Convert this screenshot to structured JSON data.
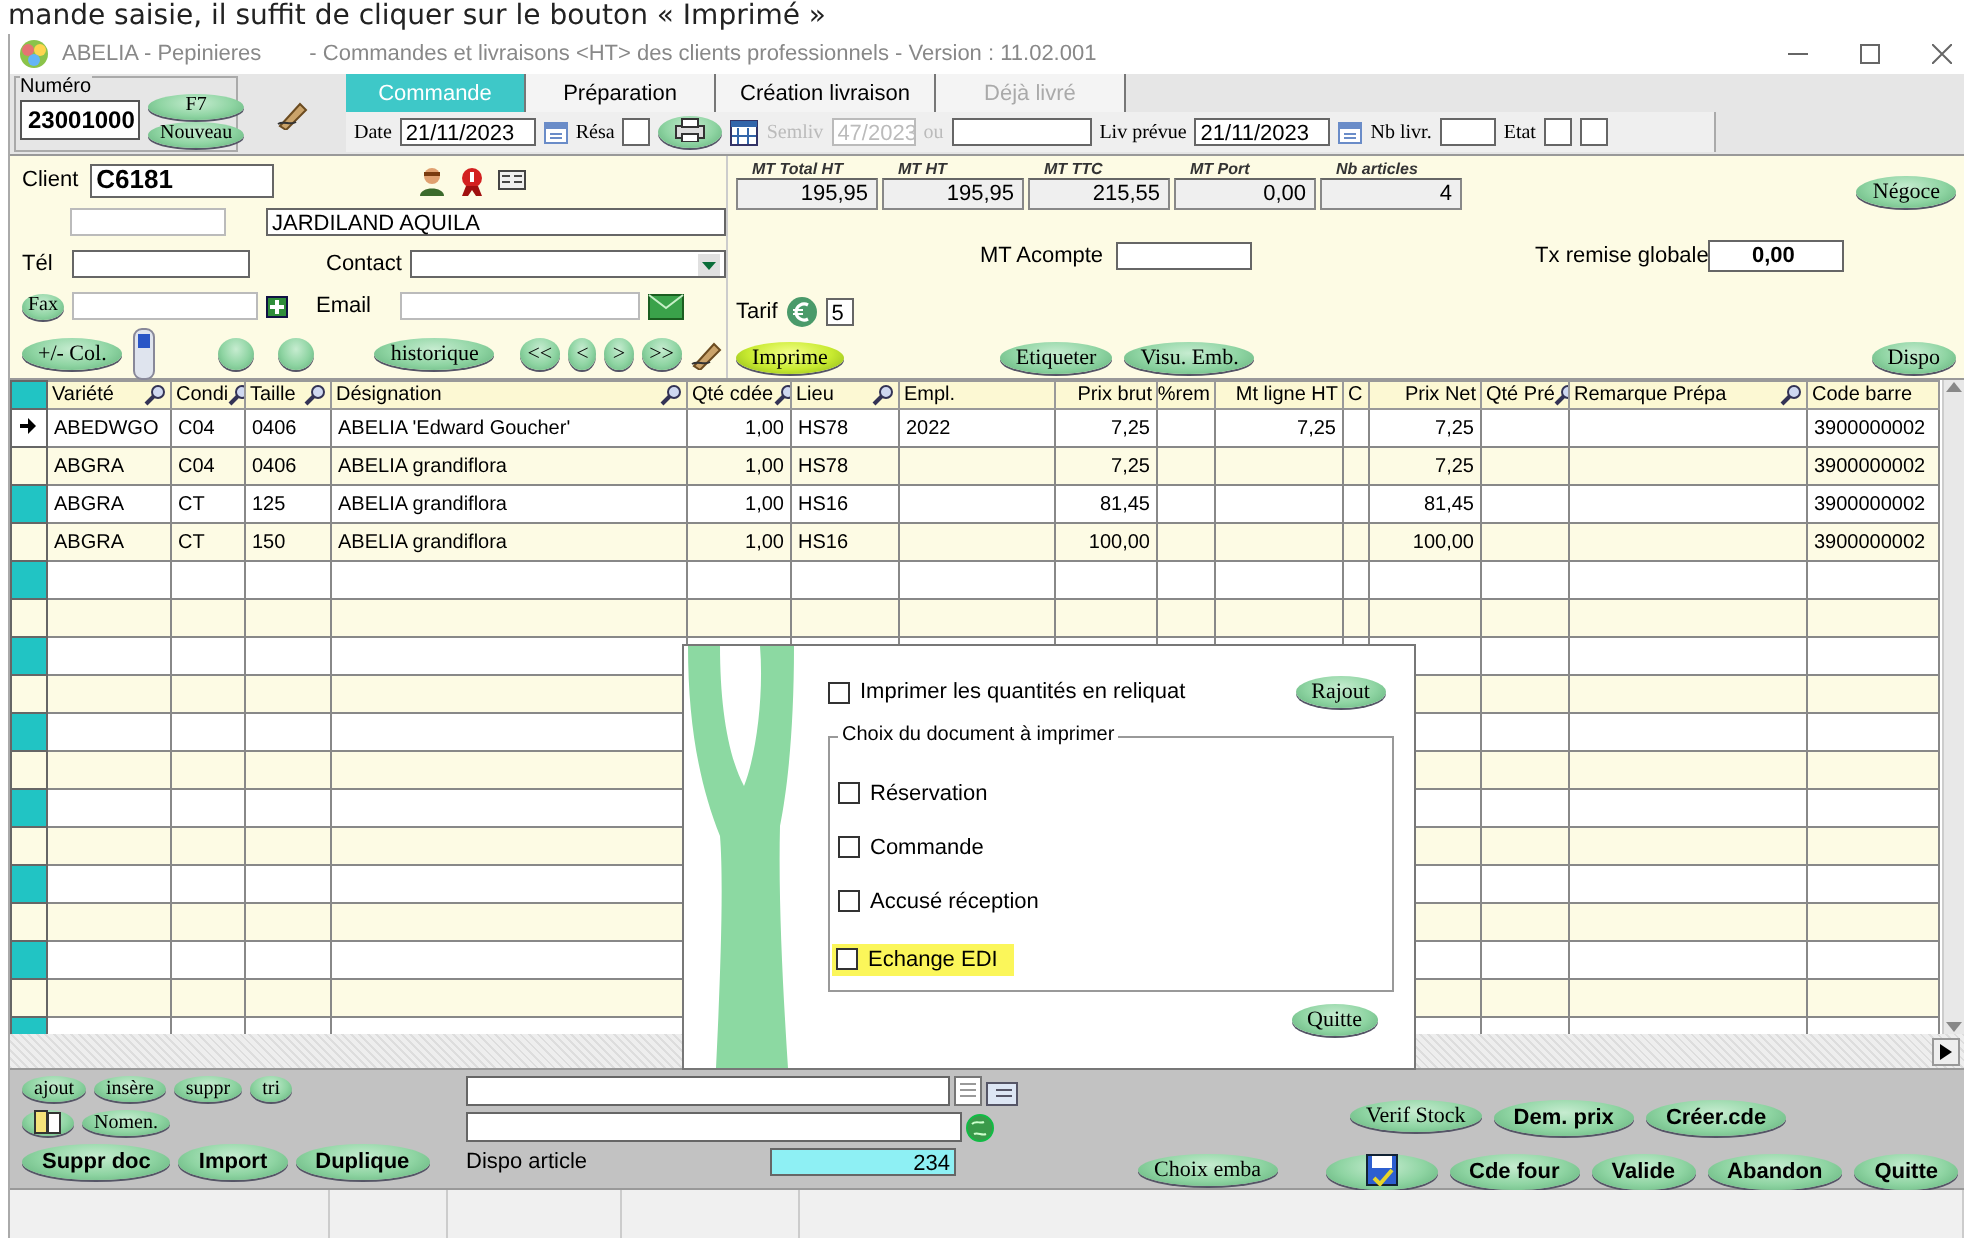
{
  "caption": "mande saisie, il suffit de cliquer sur le bouton « Imprimé »",
  "window": {
    "app": "ABELIA  -  Pepinieres",
    "title": "-  Commandes et livraisons <HT> des clients professionnels  -  Version : 11.02.001"
  },
  "numero": {
    "label": "Numéro",
    "value": "23001000",
    "buttons": [
      "F7",
      "Nouveau"
    ]
  },
  "tabs": [
    {
      "label": "Commande",
      "selected": true,
      "disabled": false
    },
    {
      "label": "Préparation",
      "selected": false,
      "disabled": false
    },
    {
      "label": "Création livraison",
      "selected": false,
      "disabled": false
    },
    {
      "label": "Déjà livré",
      "selected": false,
      "disabled": true
    }
  ],
  "order_bar": {
    "date_label": "Date",
    "date": "21/11/2023",
    "resa_label": "Résa",
    "week_label": "Semliv",
    "week": "47/2023",
    "or_label": "ou",
    "week_disabled": true,
    "delivery_label": "Liv prévue",
    "delivery_date": "21/11/2023",
    "nb_label": "Nb livr.",
    "state_label": "Etat"
  },
  "client": {
    "label": "Client",
    "code": "C6181",
    "name": "JARDILAND AQUILA",
    "phone_label": "Tél",
    "contact_label": "Contact",
    "fax_button": "Fax",
    "email_label": "Email",
    "columns_button": "+/- Col.",
    "history_button": "historique",
    "nav_buttons": [
      "<<",
      "<",
      ">",
      ">>"
    ]
  },
  "totals": [
    {
      "label": "MT Total HT",
      "value": "195,95"
    },
    {
      "label": "MT HT",
      "value": "195,95"
    },
    {
      "label": "MT TTC",
      "value": "215,55"
    },
    {
      "label": "MT Port",
      "value": "0,00"
    },
    {
      "label": "Nb articles",
      "value": "4"
    }
  ],
  "acompte_label": "MT Acompte",
  "remise": {
    "label": "Tx remise globale",
    "value": "0,00"
  },
  "tarif": {
    "label": "Tarif",
    "value": "5"
  },
  "action_buttons": [
    {
      "label": "Imprime",
      "kind": "highlight"
    },
    {
      "label": "Etiqueter",
      "kind": "plain"
    },
    {
      "label": "Visu. Emb.",
      "kind": "plain"
    }
  ],
  "side_buttons": [
    "Négoce",
    "Dispo"
  ],
  "table": {
    "columns": [
      {
        "label": "Variété",
        "searchable": true,
        "numeric": false
      },
      {
        "label": "Condi",
        "searchable": true,
        "numeric": false
      },
      {
        "label": "Taille",
        "searchable": true,
        "numeric": false
      },
      {
        "label": "Désignation",
        "searchable": true,
        "numeric": false
      },
      {
        "label": "Qté cdée",
        "searchable": true,
        "numeric": true
      },
      {
        "label": "Lieu",
        "searchable": true,
        "numeric": false
      },
      {
        "label": "Empl.",
        "searchable": false,
        "numeric": false
      },
      {
        "label": "Prix brut",
        "searchable": false,
        "numeric": true
      },
      {
        "label": "%rem",
        "searchable": false,
        "numeric": true
      },
      {
        "label": "Mt ligne HT",
        "searchable": false,
        "numeric": true
      },
      {
        "label": "C",
        "searchable": false,
        "numeric": false
      },
      {
        "label": "Prix Net",
        "searchable": false,
        "numeric": true
      },
      {
        "label": "Qté Pré",
        "searchable": true,
        "numeric": true
      },
      {
        "label": "Remarque Prépa",
        "searchable": true,
        "numeric": false
      },
      {
        "label": "Code barre",
        "searchable": false,
        "numeric": false
      }
    ],
    "rows": [
      {
        "current": true,
        "cells": [
          "ABEDWGO",
          "C04",
          "0406",
          "ABELIA 'Edward Goucher'",
          "1,00",
          "HS78",
          "2022",
          "7,25",
          null,
          "7,25",
          null,
          "7,25",
          null,
          null,
          "3900000002"
        ]
      },
      {
        "current": false,
        "cells": [
          "ABGRA",
          "C04",
          "0406",
          "ABELIA grandiflora",
          "1,00",
          "HS78",
          null,
          "7,25",
          null,
          null,
          null,
          "7,25",
          null,
          null,
          "3900000002"
        ]
      },
      {
        "current": false,
        "cells": [
          "ABGRA",
          "CT",
          "125",
          "ABELIA grandiflora",
          "1,00",
          "HS16",
          null,
          "81,45",
          null,
          null,
          null,
          "81,45",
          null,
          null,
          "3900000002"
        ]
      },
      {
        "current": false,
        "cells": [
          "ABGRA",
          "CT",
          "150",
          "ABELIA grandiflora",
          "1,00",
          "HS16",
          null,
          "100,00",
          null,
          null,
          null,
          "100,00",
          null,
          null,
          "3900000002"
        ]
      }
    ]
  },
  "dialog": {
    "reliquat": {
      "label": "Imprimer les quantités en reliquat",
      "checked": false
    },
    "add_button": "Rajout",
    "group_title": "Choix du document à imprimer",
    "documents": [
      {
        "label": "Réservation",
        "checked": false,
        "highlighted": false
      },
      {
        "label": "Commande",
        "checked": false,
        "highlighted": false
      },
      {
        "label": "Accusé réception",
        "checked": false,
        "highlighted": false
      },
      {
        "label": "Echange EDI",
        "checked": false,
        "highlighted": true
      }
    ],
    "close_button": "Quitte"
  },
  "edit_buttons": [
    "ajout",
    "insère",
    "suppr",
    "tri"
  ],
  "nomen_button": "Nomen.",
  "doc_buttons": [
    "Suppr doc",
    "Import",
    "Duplique"
  ],
  "dispo": {
    "label": "Dispo article",
    "value": "234"
  },
  "stock_buttons": [
    {
      "label": "Verif Stock",
      "kind": "plain"
    },
    {
      "label": "Dem. prix",
      "kind": "bold"
    },
    {
      "label": "Créer.cde",
      "kind": "bold"
    }
  ],
  "final_buttons": [
    {
      "label": "Choix emba",
      "kind": "plain"
    },
    {
      "kind": "save"
    },
    {
      "label": "Cde four",
      "kind": "bold"
    },
    {
      "label": "Valide",
      "kind": "bold"
    },
    {
      "label": "Abandon",
      "kind": "bold"
    },
    {
      "label": "Quitte",
      "kind": "bold"
    }
  ]
}
